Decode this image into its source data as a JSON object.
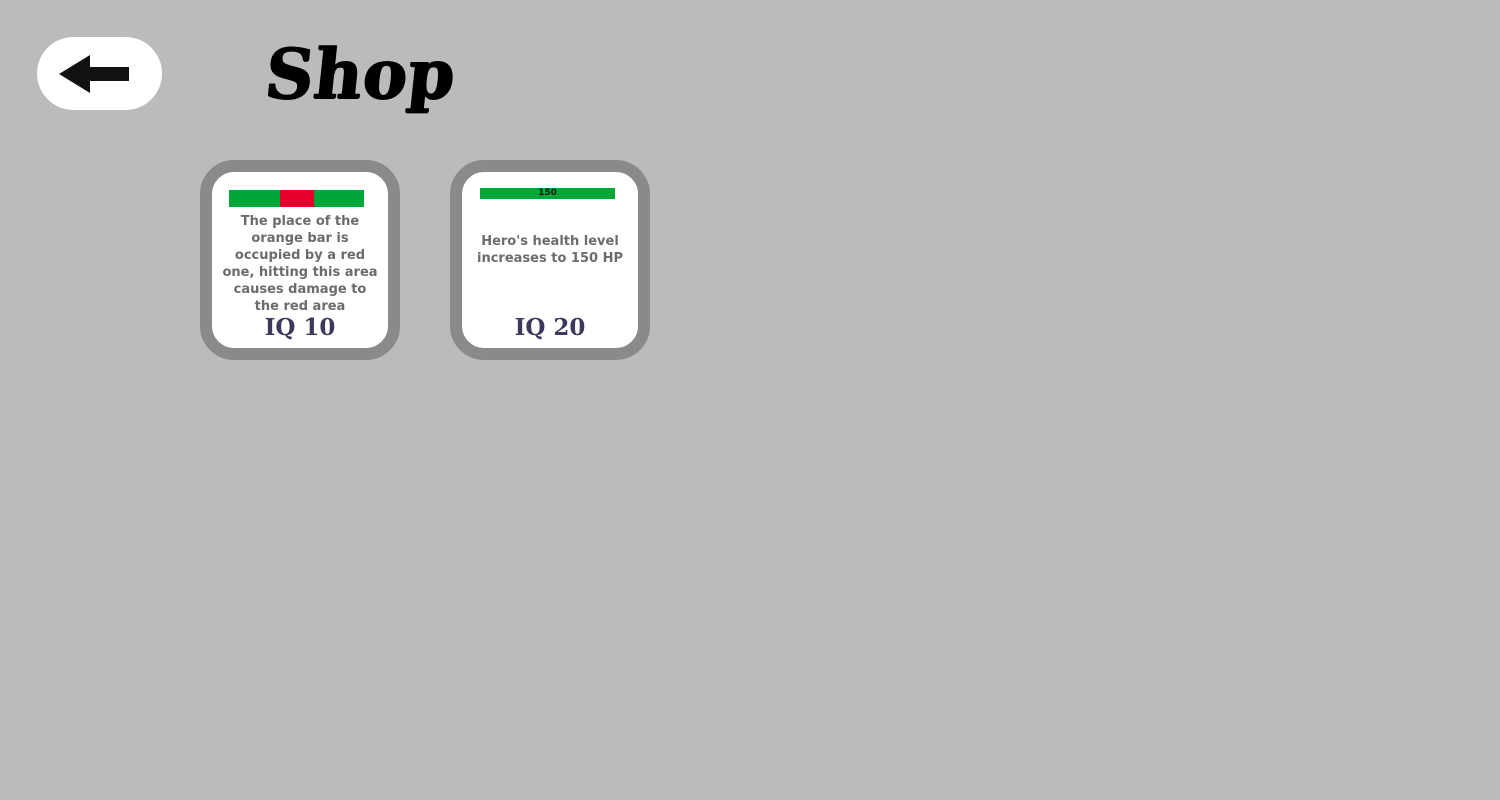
{
  "header": {
    "title": "Shop",
    "back_icon": "arrow-left-icon"
  },
  "colors": {
    "background": "#bbbbbb",
    "card_border": "#8a8a8a",
    "bar_green": "#00a637",
    "bar_red": "#e4002b",
    "price_text": "#3f375c",
    "description_text": "#6b6b6b"
  },
  "shop": {
    "items": [
      {
        "description": "The place of the orange bar is occupied by a red one, hitting this area causes damage to the red area",
        "price": "IQ 10"
      },
      {
        "bar_label": "150",
        "description": "Hero's health level increases to 150 HP",
        "price": "IQ 20"
      }
    ]
  }
}
